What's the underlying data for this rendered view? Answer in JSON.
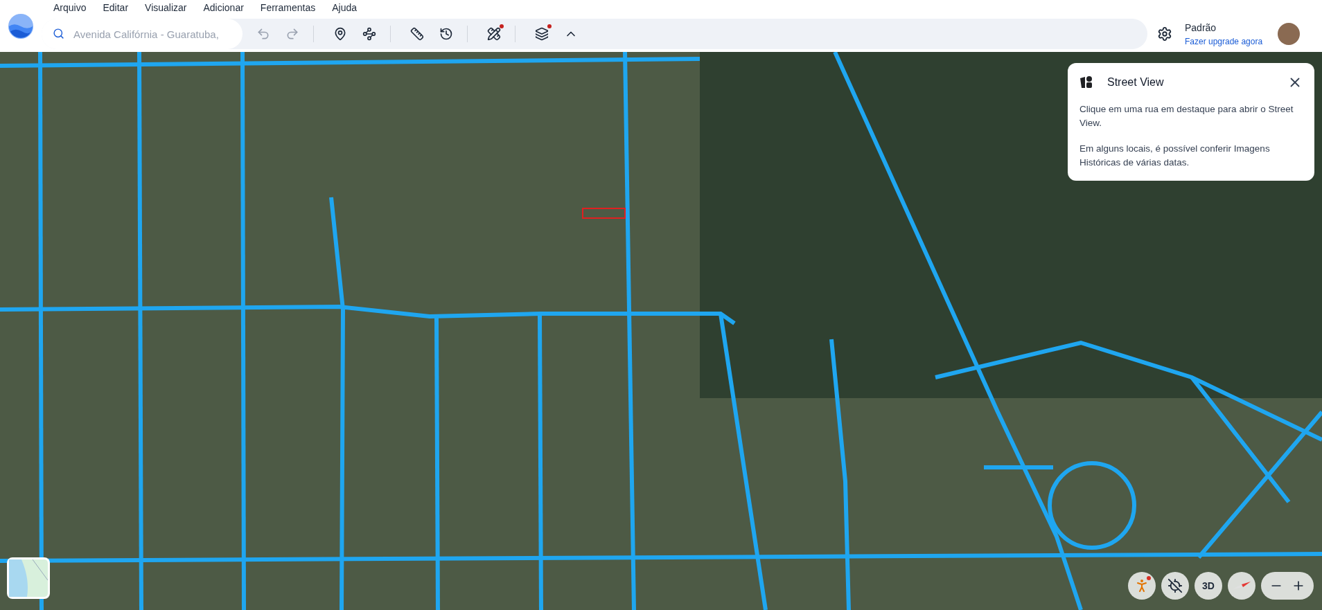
{
  "menu": [
    "Arquivo",
    "Editar",
    "Visualizar",
    "Adicionar",
    "Ferramentas",
    "Ajuda"
  ],
  "search": {
    "value": "Avenida Califórnia - Guaratuba,"
  },
  "toolbar_groups": [
    [
      {
        "kind": "undo",
        "disabled": true,
        "badge": false
      },
      {
        "kind": "redo",
        "disabled": true,
        "badge": false
      }
    ],
    [
      {
        "kind": "pin",
        "disabled": false,
        "badge": false
      },
      {
        "kind": "path",
        "disabled": false,
        "badge": false
      }
    ],
    [
      {
        "kind": "ruler",
        "disabled": false,
        "badge": false
      },
      {
        "kind": "history",
        "disabled": false,
        "badge": false
      }
    ],
    [
      {
        "kind": "tools",
        "disabled": false,
        "badge": true
      }
    ],
    [
      {
        "kind": "layers",
        "disabled": false,
        "badge": true
      },
      {
        "kind": "collapse",
        "disabled": false,
        "badge": false
      }
    ]
  ],
  "account": {
    "profile": "Padrão",
    "upgrade_link": "Fazer upgrade agora"
  },
  "street_view_card": {
    "title": "Street View",
    "paragraphs": [
      "Clique em uma rua em destaque para abrir o Street View.",
      "Em alguns locais, é possível conferir Imagens Históricas de várias datas."
    ]
  },
  "map_controls": {
    "pegman_badge": true,
    "view_3d": "3D"
  }
}
